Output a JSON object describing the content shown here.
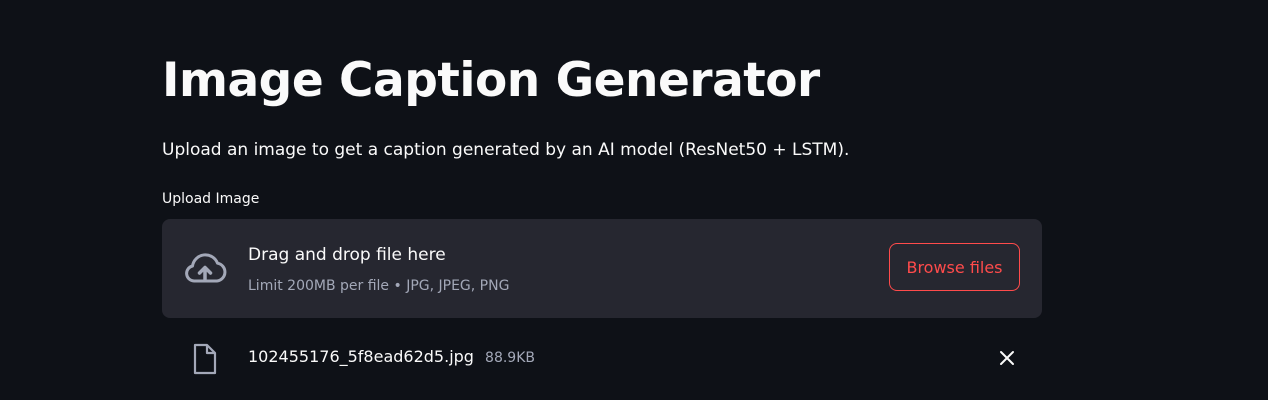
{
  "header": {
    "title": "Image Caption Generator",
    "description": "Upload an image to get a caption generated by an AI model (ResNet50 + LSTM)."
  },
  "uploader": {
    "label": "Upload Image",
    "drop_title": "Drag and drop file here",
    "drop_limit": "Limit 200MB per file • JPG, JPEG, PNG",
    "browse_label": "Browse files",
    "icon": "cloud-upload-icon"
  },
  "uploaded_file": {
    "name": "102455176_5f8ead62d5.jpg",
    "size": "88.9KB",
    "icon": "file-icon",
    "remove_icon": "close-icon"
  },
  "colors": {
    "background": "#0e1117",
    "panel": "#262730",
    "accent": "#ff4b4b",
    "text": "#fafafa",
    "muted_text": "#a3a8b8"
  }
}
